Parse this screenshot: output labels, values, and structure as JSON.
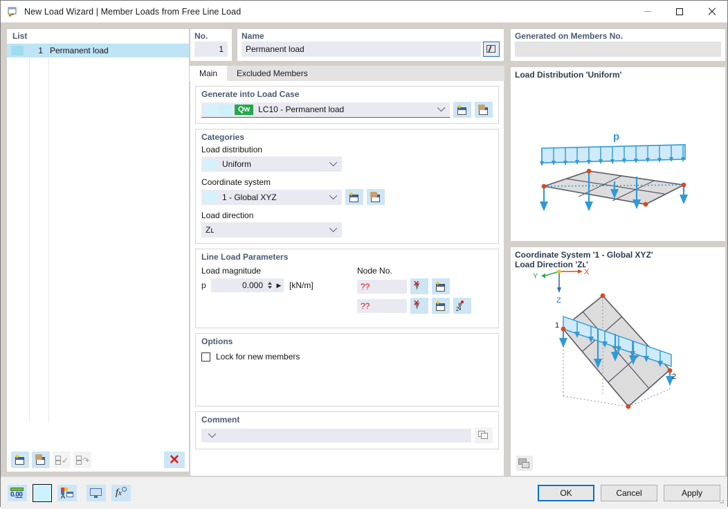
{
  "window": {
    "title": "New Load Wizard | Member Loads from Free Line Load",
    "icon": "load-wizard-icon",
    "minimize": "minimize-icon",
    "maximize": "maximize-icon",
    "close": "close-icon"
  },
  "list": {
    "header": "List",
    "rows": [
      {
        "no": "1",
        "name": "Permanent load",
        "color": "#9fdcf0"
      }
    ],
    "toolbar": [
      {
        "name": "new-item-button",
        "icon": "new-document-icon",
        "enabled": true
      },
      {
        "name": "copy-item-button",
        "icon": "copy-document-icon",
        "enabled": true
      },
      {
        "name": "select-all-button",
        "icon": "check-all-icon",
        "enabled": false
      },
      {
        "name": "invert-selection-button",
        "icon": "invert-check-icon",
        "enabled": false
      },
      {
        "name": "delete-item-button",
        "icon": "red-x-icon",
        "enabled": true
      }
    ],
    "delete_glyph": "✕"
  },
  "no_field": {
    "caption": "No.",
    "value": "1"
  },
  "name_field": {
    "caption": "Name",
    "value": "Permanent load",
    "edit_button": "edit-name-button",
    "edit_icon": "pencil-box-icon"
  },
  "tabs": [
    {
      "label": "Main",
      "active": true
    },
    {
      "label": "Excluded Members",
      "active": false
    }
  ],
  "generate_into_load_case": {
    "title": "Generate into Load Case",
    "badge": "Qw",
    "value": "LC10 - Permanent load",
    "new_button": "new-load-case-button",
    "edit_button": "edit-load-case-button"
  },
  "categories": {
    "title": "Categories",
    "load_distribution": {
      "label": "Load distribution",
      "value": "Uniform"
    },
    "coordinate_system": {
      "label": "Coordinate system",
      "value": "1 - Global XYZ",
      "new_button": "new-coordinate-system-button",
      "edit_button": "edit-coordinate-system-button"
    },
    "load_direction": {
      "label": "Load direction",
      "value": "Zʟ"
    }
  },
  "line_load_parameters": {
    "title": "Line Load Parameters",
    "magnitude_label": "Load magnitude",
    "magnitude_symbol": "p",
    "magnitude_value": "0.000",
    "magnitude_unit": "[kN/m]",
    "node_label": "Node No.",
    "node_rows": [
      {
        "value": "??",
        "buttons": [
          {
            "name": "pick-node-1-button",
            "icon": "cursor-select-icon"
          },
          {
            "name": "new-node-1-button",
            "icon": "new-document-icon"
          }
        ]
      },
      {
        "value": "??",
        "buttons": [
          {
            "name": "pick-node-2-button",
            "icon": "cursor-select-icon"
          },
          {
            "name": "new-node-2-button",
            "icon": "new-document-icon"
          },
          {
            "name": "pick-two-nodes-button",
            "icon": "cursor-2x-icon"
          }
        ]
      }
    ]
  },
  "options": {
    "title": "Options",
    "lock_for_new_members": {
      "label": "Lock for new members",
      "checked": false
    }
  },
  "comment": {
    "title": "Comment",
    "value": "",
    "copy_button": "comment-library-button",
    "copy_icon": "copy-windows-icon"
  },
  "generated_on_members": {
    "caption": "Generated on Members No.",
    "value": ""
  },
  "preview_top": {
    "title": "Load Distribution 'Uniform'",
    "load_symbol": "p"
  },
  "preview_bottom": {
    "title_line1": "Coordinate System '1 - Global XYZ'",
    "title_line2": "Load Direction 'Zʟ'",
    "axis_x": "X",
    "axis_y": "Y",
    "axis_z": "Z",
    "node_label_1": "1",
    "node_label_2": "2",
    "snapshot_button": "snapshot-button"
  },
  "footer": {
    "tools": [
      {
        "name": "decimal-places-button",
        "icon": "number-format-icon"
      },
      {
        "name": "color-button",
        "icon": "color-swatch-icon"
      },
      {
        "name": "display-properties-button",
        "icon": "palette-window-icon"
      },
      {
        "name": "graphic-settings-button",
        "icon": "monitor-icon"
      },
      {
        "name": "formula-button",
        "icon": "fx-icon"
      }
    ],
    "ok": "OK",
    "cancel": "Cancel",
    "apply": "Apply"
  },
  "colors": {
    "accent_blue": "#0a72c4",
    "badge_green": "#22a84a",
    "field_bg": "#e9e9f2",
    "icon_btn_bg": "#cde5f5",
    "error_red": "#d21919",
    "caption_blue": "#4a5a73",
    "diagram_blue": "#2f9ad6",
    "node_red": "#d94a1e"
  }
}
